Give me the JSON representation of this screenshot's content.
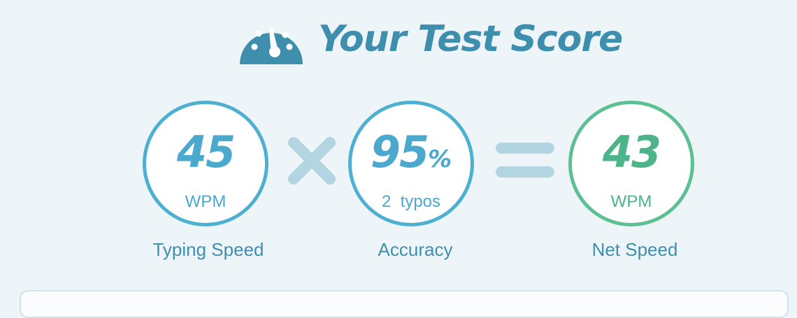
{
  "header": {
    "title": "Your Test Score",
    "icon": "speedometer-icon"
  },
  "stats": {
    "speed": {
      "value": "45",
      "unit": "WPM",
      "label": "Typing Speed"
    },
    "accuracy": {
      "value": "95",
      "suffix": "%",
      "sub": "2  typos",
      "label": "Accuracy"
    },
    "net": {
      "value": "43",
      "unit": "WPM",
      "label": "Net Speed"
    }
  },
  "colors": {
    "blue": "#4db0d1",
    "green": "#5cc092",
    "title": "#3e8fad",
    "operator": "#b3d5e1",
    "background": "#eef5f9"
  }
}
